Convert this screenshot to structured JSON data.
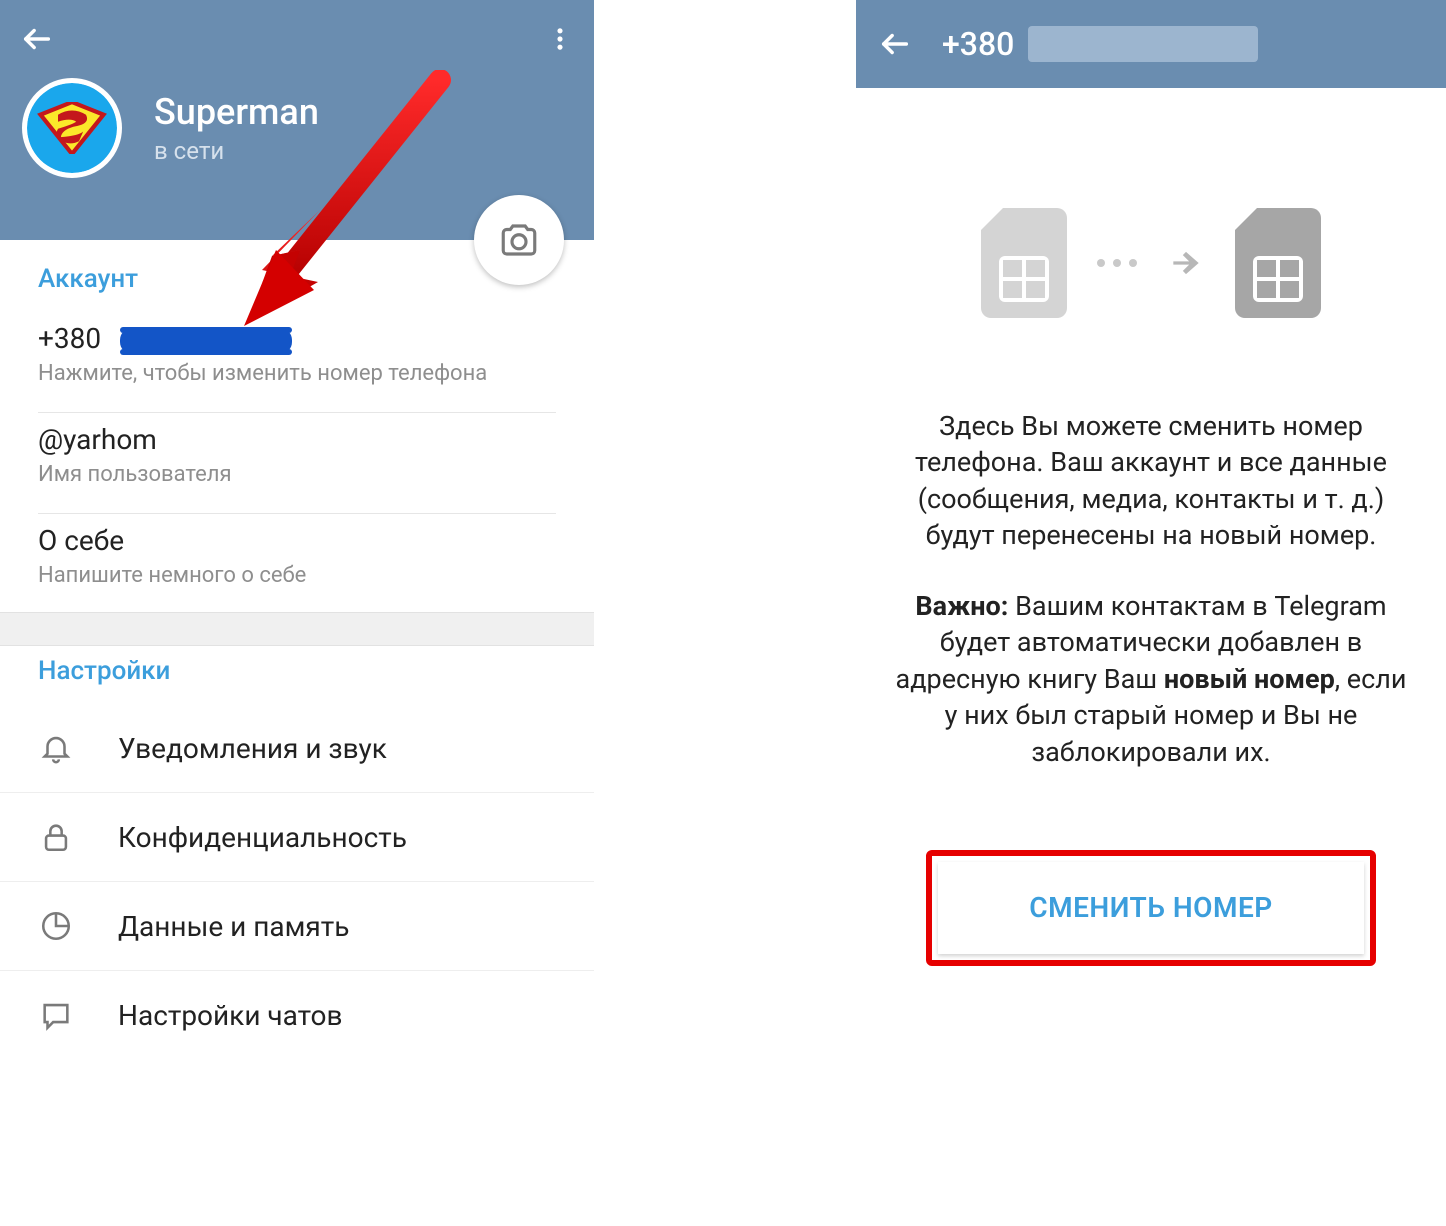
{
  "left": {
    "profile": {
      "name": "Superman",
      "status": "в сети"
    },
    "account": {
      "section_title": "Аккаунт",
      "phone_prefix": "+380",
      "phone_hint": "Нажмите, чтобы изменить номер телефона",
      "username": "@yarhom",
      "username_hint": "Имя пользователя",
      "bio_label": "О себе",
      "bio_hint": "Напишите немного о себе"
    },
    "settings": {
      "section_title": "Настройки",
      "items": [
        {
          "label": "Уведомления и звук"
        },
        {
          "label": "Конфиденциальность"
        },
        {
          "label": "Данные и память"
        },
        {
          "label": "Настройки чатов"
        }
      ]
    }
  },
  "right": {
    "title_prefix": "+380",
    "paragraph1": "Здесь Вы можете сменить номер телефона. Ваш аккаунт и все данные (сообщения, медиа, контакты и т. д.) будут перенесены на новый номер.",
    "paragraph2_before": "Важно:",
    "paragraph2_mid": " Вашим контактам в Telegram будет автоматически добавлен в адресную книгу Ваш ",
    "paragraph2_bold": "новый номер",
    "paragraph2_after": ", если у них был старый номер и Вы не заблокировали их.",
    "button_label": "СМЕНИТЬ НОМЕР"
  }
}
